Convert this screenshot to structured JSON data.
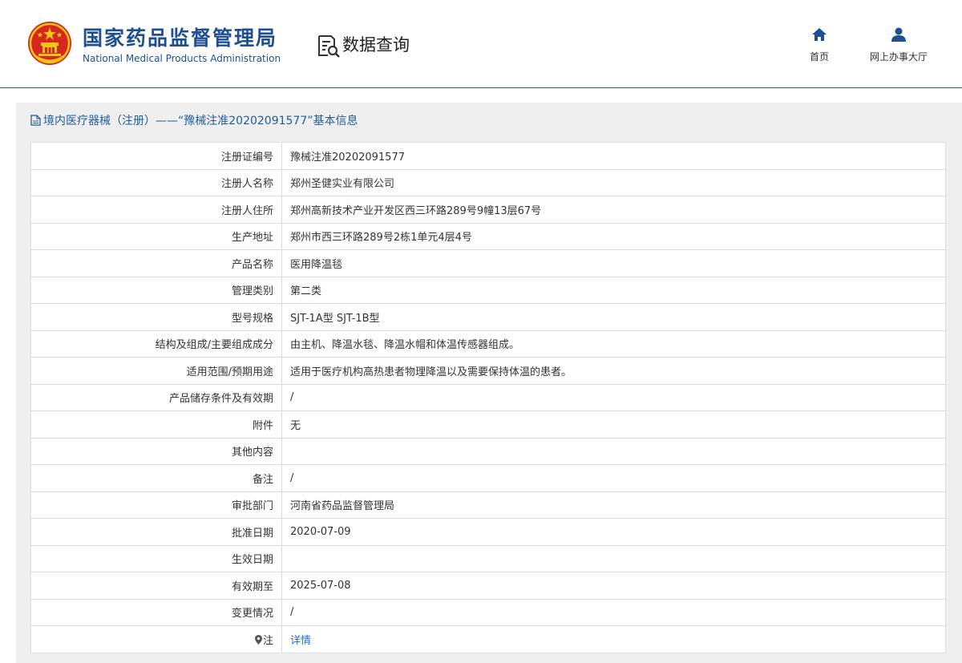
{
  "header": {
    "brand_cn": "国家药品监督管理局",
    "brand_en": "National Medical Products Administration",
    "section_title": "数据查询",
    "nav": {
      "home_label": "首页",
      "service_label": "网上办事大厅"
    }
  },
  "panel": {
    "title": "境内医疗器械（注册）——“豫械注准20202091577”基本信息"
  },
  "rows": [
    {
      "label": "注册证编号",
      "value": "豫械注准20202091577"
    },
    {
      "label": "注册人名称",
      "value": "郑州圣健实业有限公司"
    },
    {
      "label": "注册人住所",
      "value": "郑州高新技术产业开发区西三环路289号9幢13层67号"
    },
    {
      "label": "生产地址",
      "value": "郑州市西三环路289号2栋1单元4层4号"
    },
    {
      "label": "产品名称",
      "value": "医用降温毯"
    },
    {
      "label": "管理类别",
      "value": "第二类"
    },
    {
      "label": "型号规格",
      "value": "SJT-1A型 SJT-1B型"
    },
    {
      "label": "结构及组成/主要组成成分",
      "value": "由主机、降温水毯、降温水帽和体温传感器组成。"
    },
    {
      "label": "适用范围/预期用途",
      "value": "适用于医疗机构高热患者物理降温以及需要保持体温的患者。"
    },
    {
      "label": "产品储存条件及有效期",
      "value": "/"
    },
    {
      "label": "附件",
      "value": "无"
    },
    {
      "label": "其他内容",
      "value": ""
    },
    {
      "label": "备注",
      "value": "/"
    },
    {
      "label": "审批部门",
      "value": "河南省药品监督管理局"
    },
    {
      "label": "批准日期",
      "value": "2020-07-09"
    },
    {
      "label": "生效日期",
      "value": ""
    },
    {
      "label": "有效期至",
      "value": "2025-07-08"
    },
    {
      "label": "变更情况",
      "value": "/"
    }
  ],
  "note": {
    "label": "注",
    "link_text": "详情"
  },
  "colors": {
    "brand": "#1e4f92",
    "link": "#1f6fd0",
    "emblem_red": "#d7261e",
    "emblem_gold": "#f5c518"
  }
}
